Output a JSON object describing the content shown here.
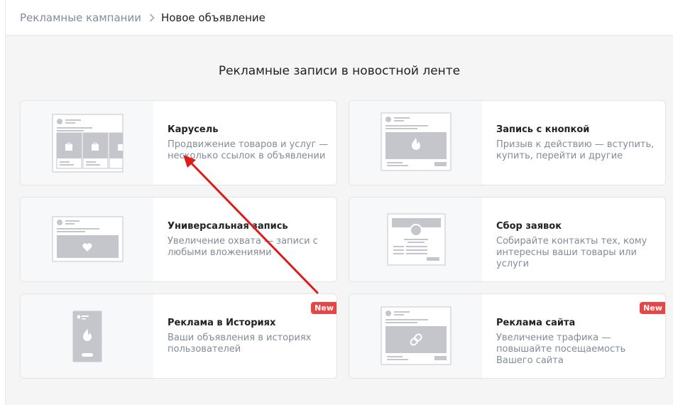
{
  "breadcrumb": {
    "parent": "Рекламные кампании",
    "current": "Новое объявление"
  },
  "section_title": "Рекламные записи в новостной ленте",
  "cards": [
    {
      "title": "Карусель",
      "desc": "Продвижение товаров и услуг — несколько ссылок в объявлении",
      "badge": ""
    },
    {
      "title": "Запись с кнопкой",
      "desc": "Призыв к действию — вступить, купить, перейти и другие",
      "badge": ""
    },
    {
      "title": "Универсальная запись",
      "desc": "Увеличение охвата — записи с любыми вложениями",
      "badge": ""
    },
    {
      "title": "Сбор заявок",
      "desc": "Собирайте контакты тех, кому интересны ваши товары или услуги",
      "badge": ""
    },
    {
      "title": "Реклама в Историях",
      "desc": "Ваши объявления в историях пользователей",
      "badge": "New"
    },
    {
      "title": "Реклама сайта",
      "desc": "Увеличение трафика — повышайте посещаемость Вашего сайта",
      "badge": "New"
    }
  ],
  "colors": {
    "badge": "#e64646",
    "arrow": "#e01b1b",
    "placeholder": "#c4c6cc"
  }
}
